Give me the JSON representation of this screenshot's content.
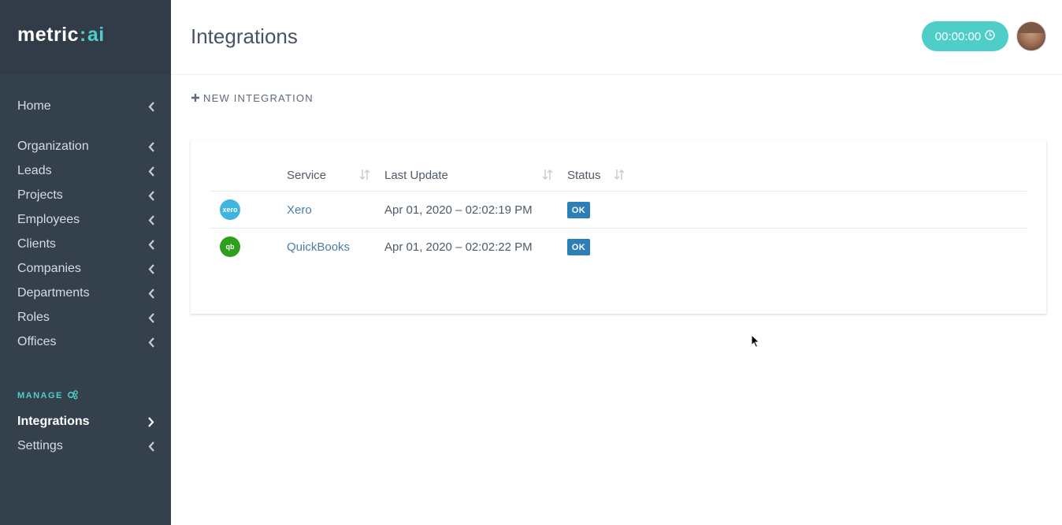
{
  "app": {
    "logo_main": "metric",
    "logo_sep": ":",
    "logo_ai": "ai"
  },
  "sidebar": {
    "items": [
      {
        "label": "Home"
      },
      {
        "label": "Organization"
      },
      {
        "label": "Leads"
      },
      {
        "label": "Projects"
      },
      {
        "label": "Employees"
      },
      {
        "label": "Clients"
      },
      {
        "label": "Companies"
      },
      {
        "label": "Departments"
      },
      {
        "label": "Roles"
      },
      {
        "label": "Offices"
      }
    ],
    "manage_label": "MANAGE",
    "manage_items": [
      {
        "label": "Integrations",
        "active": true
      },
      {
        "label": "Settings",
        "active": false
      }
    ]
  },
  "header": {
    "title": "Integrations",
    "timer": "00:00:00"
  },
  "toolbar": {
    "new_integration": "NEW INTEGRATION"
  },
  "table": {
    "columns": [
      "Service",
      "Last Update",
      "Status"
    ],
    "rows": [
      {
        "icon": "xero-icon",
        "icon_text": "xero",
        "icon_color": "#3fb4e0",
        "service": "Xero",
        "last_update": "Apr 01, 2020 – 02:02:19 PM",
        "status": "OK"
      },
      {
        "icon": "quickbooks-icon",
        "icon_text": "qb",
        "icon_color": "#2ca01c",
        "service": "QuickBooks",
        "last_update": "Apr 01, 2020 – 02:02:22 PM",
        "status": "OK"
      }
    ]
  },
  "colors": {
    "sidebar_bg": "#35404d",
    "accent": "#4ecdc9",
    "badge_ok": "#2e7fb8",
    "link": "#4a7fa8"
  }
}
